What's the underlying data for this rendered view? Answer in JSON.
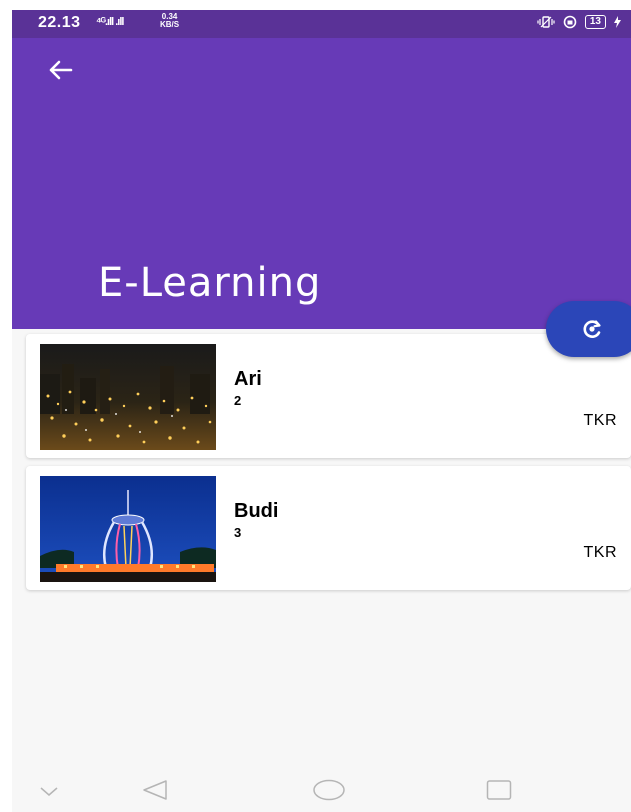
{
  "status_bar": {
    "time": "22.13",
    "signal": "⁴ᴳ.ıll .ıll",
    "speed_value": "0.34",
    "speed_unit": "KB/S",
    "battery": "13"
  },
  "app_bar": {
    "title": "E-Learning",
    "back_icon": "arrow-left-icon",
    "background": "#673ab7"
  },
  "fab": {
    "icon": "refresh-icon",
    "color": "#2b46b8"
  },
  "items": [
    {
      "name": "Ari",
      "number": "2",
      "dept": "TKR",
      "image": "city-night-photo"
    },
    {
      "name": "Budi",
      "number": "3",
      "dept": "TKR",
      "image": "monument-night-photo"
    }
  ],
  "nav_bar": {
    "icons": [
      "chevron-down-icon",
      "back-triangle-icon",
      "home-circle-icon",
      "recents-square-icon"
    ]
  }
}
